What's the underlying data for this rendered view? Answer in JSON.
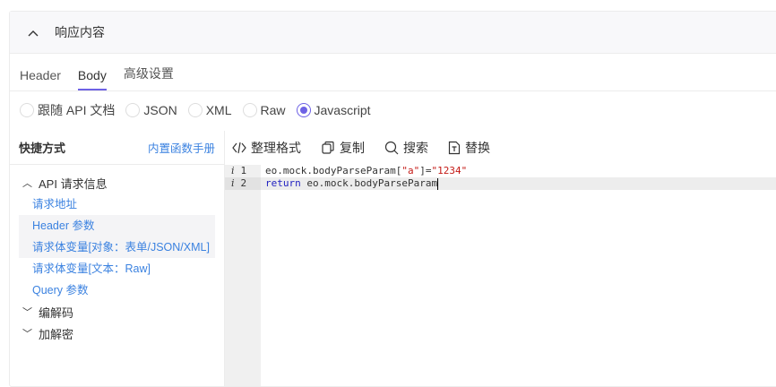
{
  "section": {
    "title": "响应内容"
  },
  "tabs": [
    {
      "label": "Header"
    },
    {
      "label": "Body"
    },
    {
      "label": "高级设置"
    }
  ],
  "radios": [
    {
      "label": "跟随 API 文档"
    },
    {
      "label": "JSON"
    },
    {
      "label": "XML"
    },
    {
      "label": "Raw"
    },
    {
      "label": "Javascript"
    }
  ],
  "selected_radio": "Javascript",
  "shortcuts": {
    "title": "快捷方式",
    "manual_link": "内置函数手册",
    "group_api": "API 请求信息",
    "links": [
      "请求地址",
      "Header 参数",
      "请求体变量[对象：表单/JSON/XML]",
      "请求体变量[文本：Raw]",
      "Query 参数"
    ],
    "group_codec": "编解码",
    "group_crypto": "加解密"
  },
  "toolbar": {
    "format": "整理格式",
    "copy": "复制",
    "search": "搜索",
    "replace": "替换"
  },
  "code": {
    "line1_no": "1",
    "line1_a": "eo.mock.bodyParseParam[",
    "line1_s1": "\"a\"",
    "line1_b": "]=",
    "line1_s2": "\"1234\"",
    "line2_no": "2",
    "line2_kw": "return",
    "line2_rest": " eo.mock.bodyParseParam"
  },
  "colors": {
    "accent": "#6e62e5",
    "link": "#3b82e0"
  }
}
